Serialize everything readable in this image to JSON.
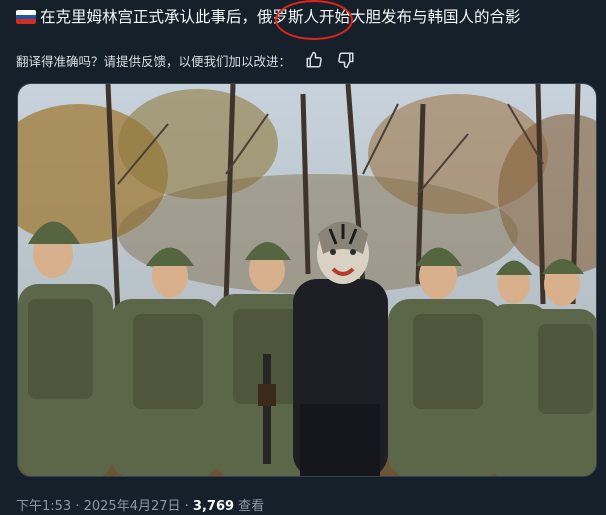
{
  "post": {
    "text_part1": "在克里姆林宫正式承认此事后，",
    "text_part2": "俄罗斯人",
    "text_part3": "开始大胆发布与韩国人的合影",
    "flag_colors": [
      "#ffffff",
      "#1c57a7",
      "#d52b1e"
    ],
    "highlight_color": "#e0241b"
  },
  "translation": {
    "prompt": "翻译得准确吗？请提供反馈，以便我们加以改进：",
    "thumbs_up_icon": "thumbs-up-icon",
    "thumbs_down_icon": "thumbs-down-icon"
  },
  "media": {
    "description_icon": "photo"
  },
  "meta": {
    "time": "下午1:53",
    "separator": " · ",
    "date": "2025年4月27日",
    "views_count": "3,769",
    "views_label": " 查看"
  }
}
